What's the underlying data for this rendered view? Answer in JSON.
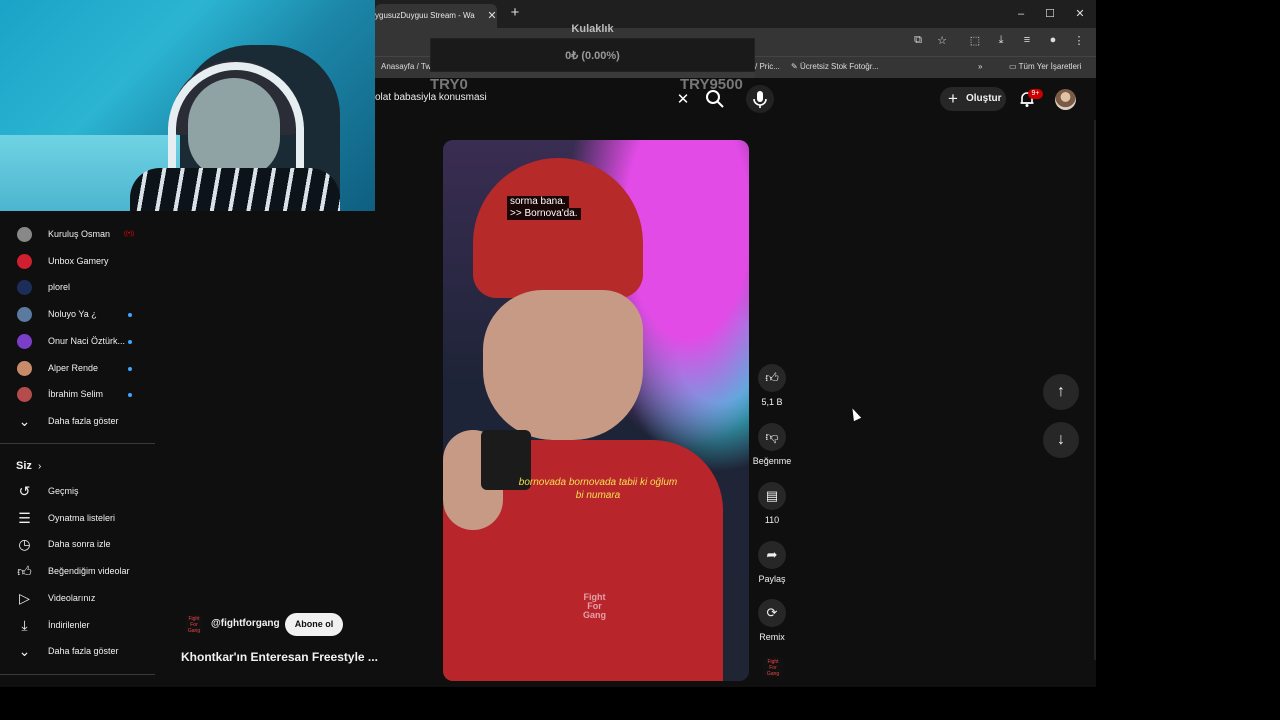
{
  "browser": {
    "tab_title": "ygusuzDuyguu Stream - Wa",
    "new_tab_symbol": "+",
    "window_controls": [
      "–",
      "☐",
      "✕"
    ],
    "bookmarks": [
      {
        "label": "Anasayfa / Tw"
      },
      {
        "label": "/ Pric..."
      },
      {
        "label": "Ücretsiz Stok Fotoğr..."
      },
      {
        "label": "»"
      },
      {
        "label": "Tüm Yer İşaretleri"
      }
    ]
  },
  "overlay": {
    "title": "Kulaklık",
    "value": "0₺ (0.00%)",
    "progress_fraction": 0.0,
    "min_label": "TRY0",
    "max_label": "TRY9500"
  },
  "header": {
    "search_query": "olat babasiyla konusmasi",
    "create_label": "Oluştur",
    "notifications_badge": "9+"
  },
  "sidebar": {
    "subscriptions": [
      {
        "label": "Kuruluş Osman",
        "avatar_color": "#888888",
        "indicator": "live"
      },
      {
        "label": "Unbox Gamery",
        "avatar_color": "#d01f2f",
        "indicator": "none"
      },
      {
        "label": "plorel",
        "avatar_color": "#1c2d5a",
        "indicator": "none"
      },
      {
        "label": "Noluyo Ya ¿",
        "avatar_color": "#5a7aa0",
        "indicator": "dot"
      },
      {
        "label": "Onur Naci Öztürk...",
        "avatar_color": "#7a3ec8",
        "indicator": "dot"
      },
      {
        "label": "Alper Rende",
        "avatar_color": "#c78b6a",
        "indicator": "dot"
      },
      {
        "label": "İbrahim Selim",
        "avatar_color": "#b44c4c",
        "indicator": "dot"
      }
    ],
    "show_more_1": "Daha fazla göster",
    "section_you": "Siz",
    "you_items": [
      {
        "label": "Geçmiş",
        "icon": "history-icon"
      },
      {
        "label": "Oynatma listeleri",
        "icon": "playlist-icon"
      },
      {
        "label": "Daha sonra izle",
        "icon": "watch-later-icon"
      },
      {
        "label": "Beğendiğim videolar",
        "icon": "like-icon"
      },
      {
        "label": "Videolarınız",
        "icon": "your-videos-icon"
      },
      {
        "label": "İndirilenler",
        "icon": "download-icon"
      }
    ],
    "show_more_2": "Daha fazla göster"
  },
  "short": {
    "subtitle_top_1": "sorma bana.",
    "subtitle_top_2": ">> Bornova'da.",
    "subtitle_mid_1": "bornovada bornovada tabii ki oğlum",
    "subtitle_mid_2": "bi numara",
    "watermark_1": "Fight",
    "watermark_2": "For",
    "watermark_3": "Gang",
    "channel_name": "@fightforgang",
    "subscribe_label": "Abone ol",
    "title": "Khontkar'ın Enteresan Freestyle ..."
  },
  "actions": {
    "likes": "5,1 B",
    "dislike_label": "Beğenme",
    "comments": "110",
    "share_label": "Paylaş",
    "remix_label": "Remix"
  },
  "colors": {
    "accent_red": "#cc0000",
    "background": "#0f0f0f",
    "button_bg": "#272727"
  }
}
